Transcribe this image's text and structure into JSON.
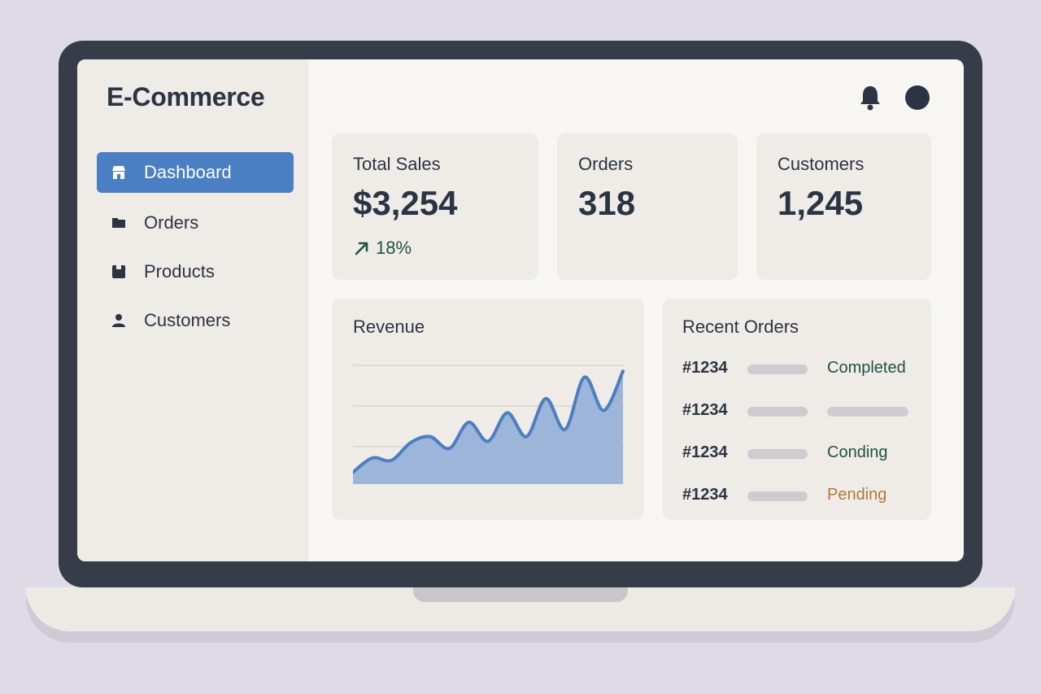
{
  "app": {
    "title": "E-Commerce"
  },
  "sidebar": {
    "items": [
      {
        "label": "Dashboard",
        "icon": "store-icon",
        "active": true
      },
      {
        "label": "Orders",
        "icon": "folder-icon",
        "active": false
      },
      {
        "label": "Products",
        "icon": "box-icon",
        "active": false
      },
      {
        "label": "Customers",
        "icon": "user-icon",
        "active": false
      }
    ]
  },
  "header": {
    "icons": [
      "bell-icon",
      "avatar"
    ]
  },
  "stats": [
    {
      "label": "Total Sales",
      "value": "$3,254",
      "trend": "18%",
      "trend_direction": "up"
    },
    {
      "label": "Orders",
      "value": "318"
    },
    {
      "label": "Customers",
      "value": "1,245"
    }
  ],
  "revenue": {
    "title": "Revenue",
    "chart_data": {
      "type": "area",
      "values": [
        10,
        22,
        20,
        35,
        40,
        30,
        52,
        36,
        60,
        40,
        72,
        46,
        90,
        62,
        95
      ]
    }
  },
  "recent_orders": {
    "title": "Recent Orders",
    "rows": [
      {
        "id": "#1234",
        "status": "Completed",
        "status_color": "#1f5248"
      },
      {
        "id": "#1234",
        "status": "",
        "status_color": ""
      },
      {
        "id": "#1234",
        "status": "Conding",
        "status_color": "#1f5248"
      },
      {
        "id": "#1234",
        "status": "Pending",
        "status_color": "#b07a3a"
      }
    ]
  },
  "colors": {
    "accent": "#4a7fc4",
    "text": "#2b3442",
    "positive": "#1f5248",
    "pending": "#b07a3a"
  }
}
